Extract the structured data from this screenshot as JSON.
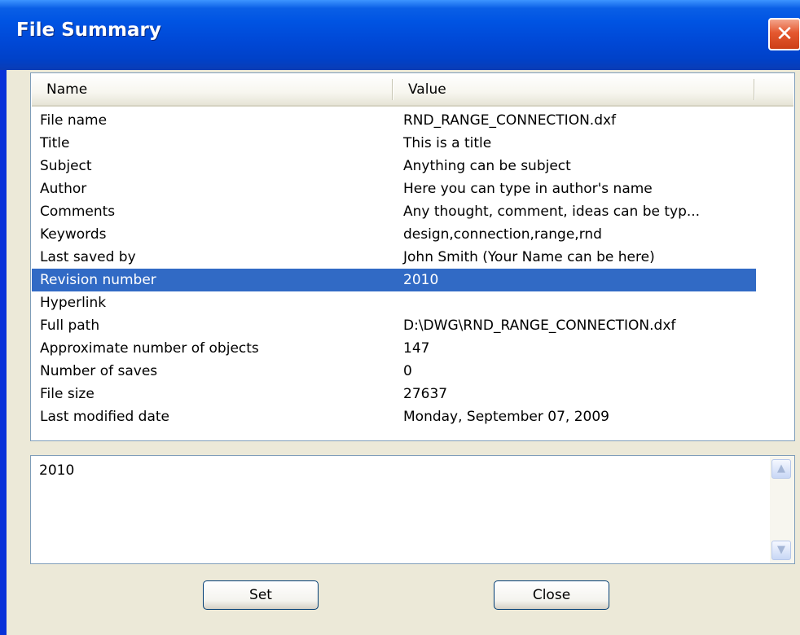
{
  "window": {
    "title": "File Summary",
    "close_glyph": "✕"
  },
  "list": {
    "columns": [
      "Name",
      "Value"
    ],
    "rows": [
      {
        "name": "File name",
        "value": "RND_RANGE_CONNECTION.dxf"
      },
      {
        "name": "Title",
        "value": "This is a title"
      },
      {
        "name": "Subject",
        "value": "Anything can be subject"
      },
      {
        "name": "Author",
        "value": "Here you can type in author's name"
      },
      {
        "name": "Comments",
        "value": "Any thought, comment, ideas can be typ..."
      },
      {
        "name": "Keywords",
        "value": "design,connection,range,rnd"
      },
      {
        "name": "Last saved by",
        "value": "John Smith (Your Name can be here)"
      },
      {
        "name": "Revision number",
        "value": "2010",
        "selected": true
      },
      {
        "name": "Hyperlink",
        "value": ""
      },
      {
        "name": "Full path",
        "value": "D:\\DWG\\RND_RANGE_CONNECTION.dxf"
      },
      {
        "name": "Approximate number of objects",
        "value": "147"
      },
      {
        "name": "Number of saves",
        "value": "0"
      },
      {
        "name": "File size",
        "value": "27637"
      },
      {
        "name": "Last modified date",
        "value": "Monday, September 07, 2009"
      }
    ]
  },
  "editor": {
    "value": "2010"
  },
  "buttons": {
    "set_label": "Set",
    "close_label": "Close"
  },
  "colors": {
    "selection": "#316ac5",
    "titlebar": "#0054e3",
    "dialog_bg": "#ece9d8"
  }
}
